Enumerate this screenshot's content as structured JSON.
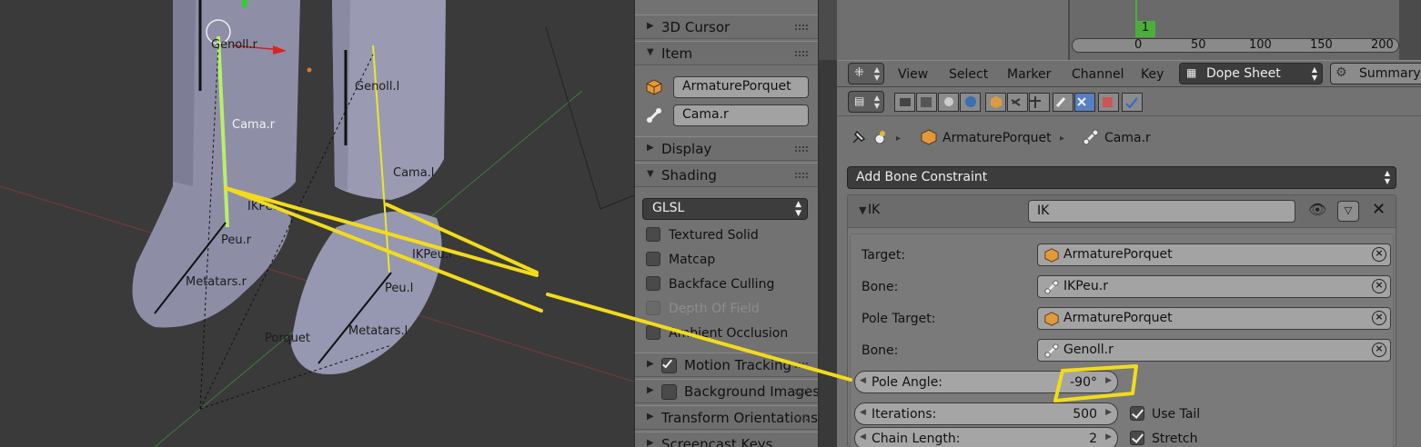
{
  "viewport": {
    "labels": {
      "genoll_r": "Genoll.r",
      "genoll_l": "Genoll.l",
      "cama_r": "Cama.r",
      "cama_l": "Cama.l",
      "ikpeu_r": "IKPeu.r",
      "ikpeu_l": "IKPeu.l",
      "peu_r": "Peu.r",
      "peu_l": "Peu.l",
      "metatars_r": "Metatars.r",
      "metatars_l": "Metatars.l",
      "porquet": "Porquet"
    }
  },
  "npanel": {
    "panels": {
      "cursor": "3D Cursor",
      "item": "Item",
      "display": "Display",
      "shading": "Shading",
      "motion_tracking": "Motion Tracking",
      "background_images": "Background Images",
      "transform_orientations": "Transform Orientations",
      "screencast_keys": "Screencast Keys"
    },
    "item_object": "ArmaturePorquet",
    "item_bone": "Cama.r",
    "shading_mode": "GLSL",
    "shading_options": {
      "textured_solid": "Textured Solid",
      "matcap": "Matcap",
      "backface_culling": "Backface Culling",
      "depth_of_field": "Depth Of Field",
      "ambient_occlusion": "Ambient Occlusion"
    }
  },
  "timeline": {
    "current_frame": "1",
    "ticks": [
      "0",
      "50",
      "100",
      "150",
      "200"
    ]
  },
  "header": {
    "menus": [
      "View",
      "Select",
      "Marker",
      "Channel",
      "Key"
    ],
    "mode": "Dope Sheet",
    "summary": "Summary"
  },
  "breadcrumb": {
    "object": "ArmaturePorquet",
    "bone": "Cama.r"
  },
  "constraints": {
    "add_label": "Add Bone Constraint",
    "ik": {
      "type": "IK",
      "name": "IK",
      "target_label": "Target:",
      "target": "ArmaturePorquet",
      "bone_label": "Bone:",
      "bone": "IKPeu.r",
      "pole_target_label": "Pole Target:",
      "pole_target": "ArmaturePorquet",
      "pole_bone_label": "Bone:",
      "pole_bone": "Genoll.r",
      "pole_angle_label": "Pole Angle:",
      "pole_angle": "-90°",
      "iterations_label": "Iterations:",
      "iterations": "500",
      "chain_length_label": "Chain Length:",
      "chain_length": "2",
      "use_tail": "Use Tail",
      "stretch": "Stretch"
    }
  },
  "colors": {
    "highlight_annotation": "#f2dc1a",
    "active_tab": "#5680c2",
    "frame_marker": "#4cae3a"
  }
}
